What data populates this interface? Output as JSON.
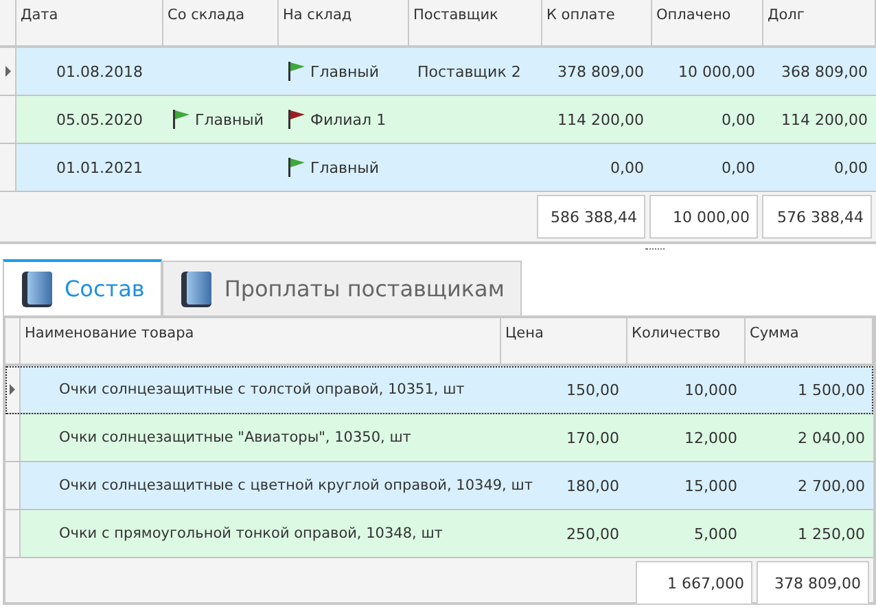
{
  "transfers": {
    "columns": [
      "Дата",
      "Со склада",
      "На склад",
      "Поставщик",
      "К оплате",
      "Оплачено",
      "Долг"
    ],
    "rows": [
      {
        "selected": true,
        "date": "01.08.2018",
        "from": null,
        "to": {
          "text": "Главный",
          "color": "#3fa83a"
        },
        "supplier": "Поставщик 2",
        "to_pay": "378 809,00",
        "paid": "10 000,00",
        "debt": "368 809,00"
      },
      {
        "selected": false,
        "date": "05.05.2020",
        "from": {
          "text": "Главный",
          "color": "#3fa83a"
        },
        "to": {
          "text": "Филиал 1",
          "color": "#9a1e22"
        },
        "supplier": "",
        "to_pay": "114 200,00",
        "paid": "0,00",
        "debt": "114 200,00"
      },
      {
        "selected": false,
        "date": "01.01.2021",
        "from": null,
        "to": {
          "text": "Главный",
          "color": "#3fa83a"
        },
        "supplier": "",
        "to_pay": "0,00",
        "paid": "0,00",
        "debt": "0,00"
      }
    ],
    "totals": [
      "586 388,44",
      "10 000,00",
      "576 388,44"
    ]
  },
  "tabs": [
    {
      "label": "Состав",
      "selected": true
    },
    {
      "label": "Проплаты поставщикам",
      "selected": false
    }
  ],
  "items": {
    "columns": [
      "Наименование товара",
      "Цена",
      "Количество",
      "Сумма"
    ],
    "rows": [
      {
        "selected": true,
        "name": "Очки солнцезащитные с толстой оправой, 10351, шт",
        "price": "150,00",
        "qty": "10,000",
        "sum": "1 500,00"
      },
      {
        "selected": false,
        "name": "Очки солнцезащитные \"Авиаторы\", 10350, шт",
        "price": "170,00",
        "qty": "12,000",
        "sum": "2 040,00"
      },
      {
        "selected": false,
        "name": "Очки солнцезащитные с цветной круглой оправой, 10349, шт",
        "price": "180,00",
        "qty": "15,000",
        "sum": "2 700,00"
      },
      {
        "selected": false,
        "name": "Очки с прямоугольной тонкой оправой, 10348, шт",
        "price": "250,00",
        "qty": "5,000",
        "sum": "1 250,00"
      }
    ],
    "totals": [
      "1 667,000",
      "378 809,00"
    ]
  }
}
